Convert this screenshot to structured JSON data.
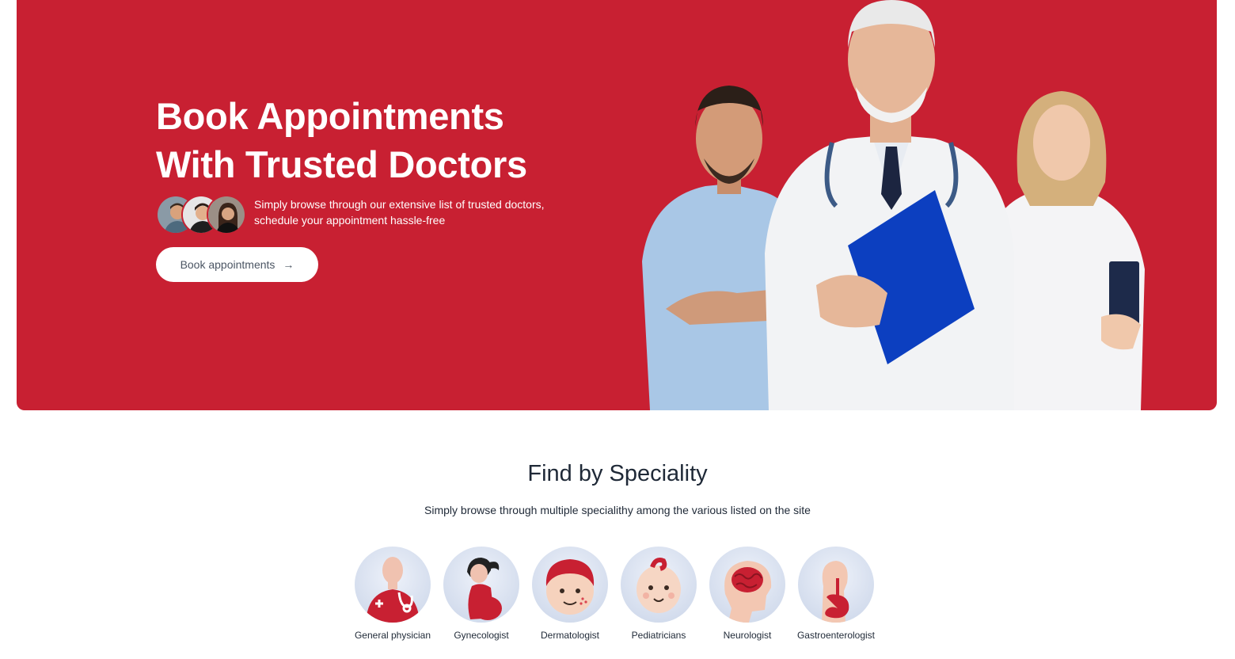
{
  "hero": {
    "title_line1": "Book Appointments",
    "title_line2": "With Trusted Doctors",
    "subtitle_line1": "Simply browse through our extensive list of trusted doctors,",
    "subtitle_line2": "schedule your appointment hassle-free",
    "cta_label": "Book appointments",
    "cta_arrow": "→",
    "background_color": "#c82032"
  },
  "speciality": {
    "title": "Find by Speciality",
    "subtitle": "Simply browse through multiple specialithy among the various listed on the site",
    "items": [
      {
        "label": "General physician",
        "icon": "general-physician-icon"
      },
      {
        "label": "Gynecologist",
        "icon": "gynecologist-icon"
      },
      {
        "label": "Dermatologist",
        "icon": "dermatologist-icon"
      },
      {
        "label": "Pediatricians",
        "icon": "pediatrician-icon"
      },
      {
        "label": "Neurologist",
        "icon": "neurologist-icon"
      },
      {
        "label": "Gastroenterologist",
        "icon": "gastroenterologist-icon"
      }
    ]
  }
}
